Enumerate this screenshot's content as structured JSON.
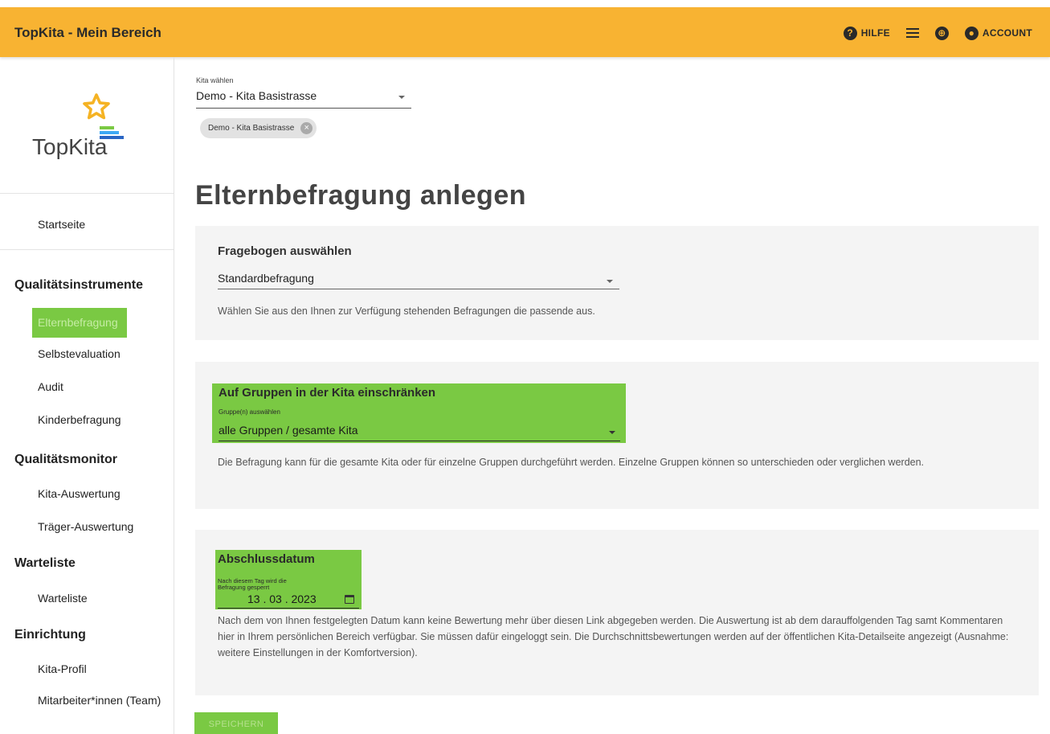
{
  "header": {
    "title": "TopKita - Mein Bereich",
    "help_label": "HILFE",
    "account_label": "ACCOUNT",
    "accent": "#f8b332"
  },
  "sidebar": {
    "logo_text": "TopKita",
    "startseite": "Startseite",
    "sections": [
      {
        "heading": "Qualitätsinstrumente",
        "items": [
          "Elternbefragung",
          "Selbstevaluation",
          "Audit",
          "Kinderbefragung"
        ]
      },
      {
        "heading": "Qualitätsmonitor",
        "items": [
          "Kita-Auswertung",
          "Träger-Auswertung"
        ]
      },
      {
        "heading": "Warteliste",
        "items": [
          "Warteliste"
        ]
      },
      {
        "heading": "Einrichtung",
        "items": [
          "Kita-Profil",
          "Mitarbeiter*innen (Team)"
        ]
      }
    ],
    "active_item": "Elternbefragung",
    "highlight_color": "#7ac943"
  },
  "kita": {
    "label": "Kita wählen",
    "selected": "Demo - Kita Basistrasse",
    "chip": "Demo - Kita Basistrasse"
  },
  "page": {
    "title": "Elternbefragung anlegen"
  },
  "questionnaire": {
    "heading": "Fragebogen auswählen",
    "value": "Standardbefragung",
    "description": "Wählen Sie aus den Ihnen zur Verfügung stehenden Befragungen die passende aus."
  },
  "groups": {
    "heading": "Auf Gruppen in der Kita einschränken",
    "label": "Gruppe(n) auswählen",
    "value": "alle Gruppen / gesamte Kita",
    "description": "Die Befragung kann für die gesamte Kita oder für einzelne Gruppen durchgeführt werden. Einzelne Gruppen können so unterschieden oder verglichen werden."
  },
  "deadline": {
    "heading": "Abschlussdatum",
    "label": "Nach diesem Tag wird die Befragung gesperrt",
    "value": "13 . 03 . 2023",
    "description": "Nach dem von Ihnen festgelegten Datum kann keine Bewertung mehr über diesen Link abgegeben werden. Die Auswertung ist ab dem darauffolgenden Tag samt Kommentaren hier in Ihrem persönlichen Bereich verfügbar. Sie müssen dafür eingeloggt sein. Die Durchschnittsbewertungen werden auf der öffentlichen Kita-Detailseite angezeigt (Ausnahme: weitere Einstellungen in der Komfortversion)."
  },
  "actions": {
    "save_label": "SPEICHERN"
  }
}
